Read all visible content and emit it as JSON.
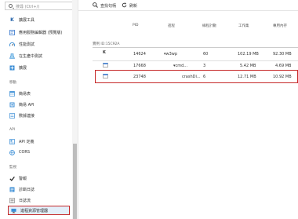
{
  "sidebar": {
    "search_placeholder": "搜尋 (Ctrl+/)",
    "items_top": [
      {
        "label": "擴展工具",
        "icon": "kudu-k-icon"
      },
      {
        "label": "應用服務編輯器 (預覽版)",
        "icon": "code-editor-icon"
      },
      {
        "label": "性能測試",
        "icon": "performance-test-icon"
      },
      {
        "label": "在生產中測試",
        "icon": "testing-in-production-icon"
      },
      {
        "label": "擴展",
        "icon": "extensions-icon"
      }
    ],
    "section_mobile": "移動",
    "items_mobile": [
      {
        "label": "簡易表",
        "icon": "easy-tables-icon"
      },
      {
        "label": "簡易 API",
        "icon": "easy-api-icon"
      },
      {
        "label": "數據連接",
        "icon": "data-connections-icon"
      }
    ],
    "section_api": "API",
    "items_api": [
      {
        "label": "API 定義",
        "icon": "api-definition-icon"
      },
      {
        "label": "CORS",
        "icon": "cors-icon"
      }
    ],
    "section_monitoring": "監視",
    "items_monitoring": [
      {
        "label": "警報",
        "icon": "alerts-check-icon"
      },
      {
        "label": "診斷日誌",
        "icon": "diagnostics-logs-icon"
      },
      {
        "label": "日誌流",
        "icon": "log-stream-icon"
      },
      {
        "label": "進程資源管理器",
        "icon": "process-explorer-icon"
      }
    ]
  },
  "toolbar": {
    "find_handle": "查找句柄",
    "refresh": "刷新"
  },
  "table": {
    "headers": [
      "PID",
      "進程",
      "線程計數",
      "工作集",
      "專用內存"
    ],
    "instance_label": "實例 ID:15C92A",
    "rows": [
      {
        "pid": "14624",
        "process": "w3wp",
        "threads": "60",
        "working_set": "102.19 MB",
        "private_memory": "92.30 MB",
        "icon": "kudu-k-icon",
        "expanded": true
      },
      {
        "pid": "17668",
        "process": "cmd...",
        "threads": "3",
        "working_set": "5.42 MB",
        "private_memory": "4.69 MB",
        "icon": "cmd-window-icon",
        "expanded": true
      },
      {
        "pid": "23748",
        "process": "crashDi...",
        "threads": "6",
        "working_set": "12.71 MB",
        "private_memory": "10.92 MB",
        "icon": "cmd-window-icon",
        "expanded": false
      }
    ]
  }
}
